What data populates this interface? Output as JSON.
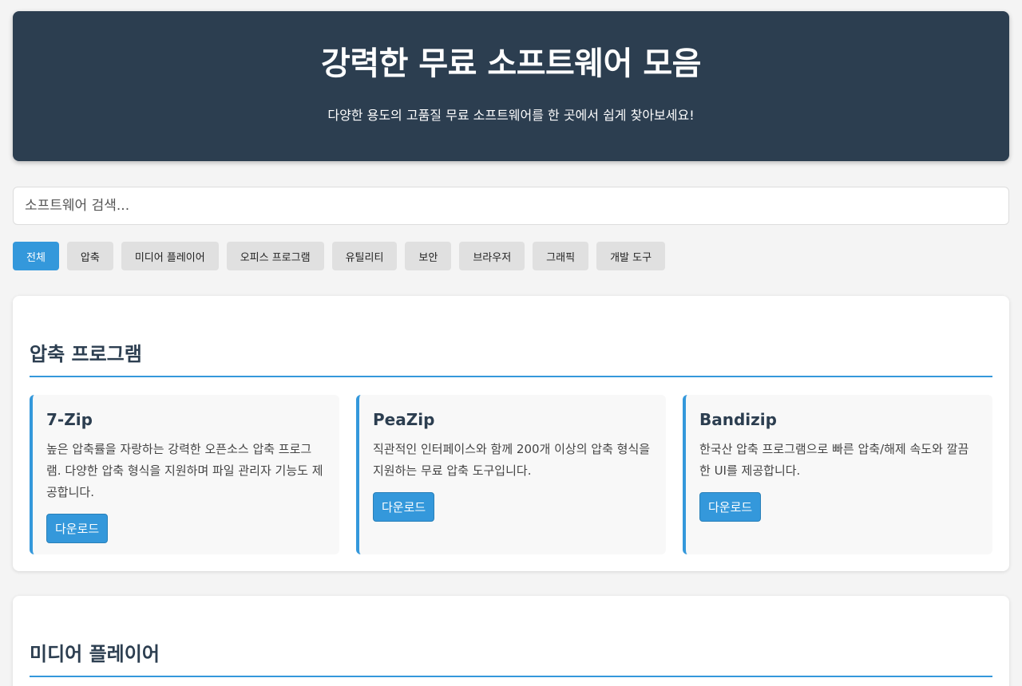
{
  "header": {
    "title": "강력한 무료 소프트웨어 모음",
    "subtitle": "다양한 용도의 고품질 무료 소프트웨어를 한 곳에서 쉽게 찾아보세요!"
  },
  "search": {
    "placeholder": "소프트웨어 검색..."
  },
  "filters": [
    {
      "label": "전체",
      "active": true
    },
    {
      "label": "압축"
    },
    {
      "label": "미디어 플레이어"
    },
    {
      "label": "오피스 프로그램"
    },
    {
      "label": "유틸리티"
    },
    {
      "label": "보안"
    },
    {
      "label": "브라우저"
    },
    {
      "label": "그래픽"
    },
    {
      "label": "개발 도구"
    }
  ],
  "sections": [
    {
      "title": "압축 프로그램",
      "cards": [
        {
          "name": "7-Zip",
          "description": "높은 압축률을 자랑하는 강력한 오픈소스 압축 프로그램. 다양한 압축 형식을 지원하며 파일 관리자 기능도 제공합니다.",
          "button": "다운로드"
        },
        {
          "name": "PeaZip",
          "description": "직관적인 인터페이스와 함께 200개 이상의 압축 형식을 지원하는 무료 압축 도구입니다.",
          "button": "다운로드"
        },
        {
          "name": "Bandizip",
          "description": "한국산 압축 프로그램으로 빠른 압축/해제 속도와 깔끔한 UI를 제공합니다.",
          "button": "다운로드"
        }
      ]
    },
    {
      "title": "미디어 플레이어"
    }
  ],
  "colors": {
    "header_bg": "#2c3e50",
    "accent": "#3498db",
    "page_bg": "#f4f4f4",
    "card_bg": "#f8f8f8",
    "filter_bg": "#e0e0e0"
  }
}
